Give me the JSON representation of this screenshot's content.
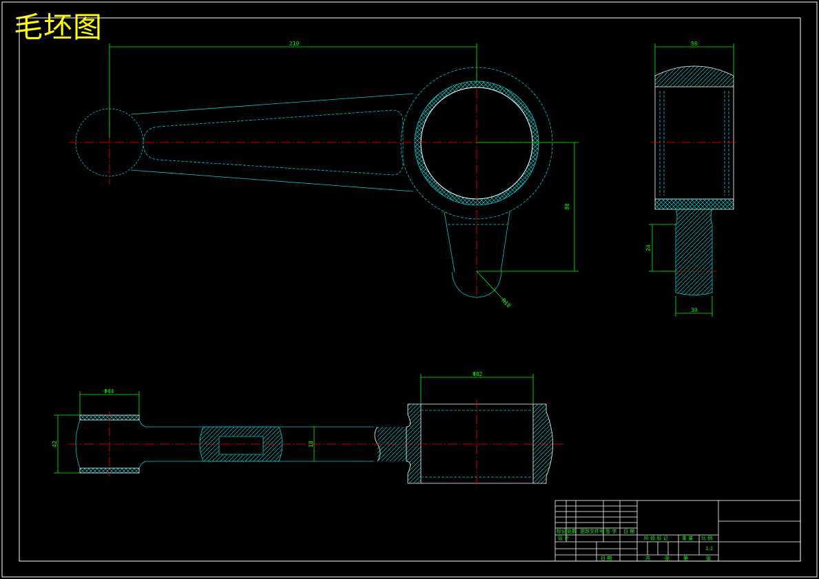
{
  "drawing": {
    "title": "毛坯图"
  },
  "dimensions": {
    "center_distance": "210",
    "big_end_width": "56",
    "offset_height": "88",
    "boss_height": "24",
    "boss_width": "30",
    "small_radius": "R18",
    "small_end_dia": "Φ44",
    "small_end_height": "42",
    "web_thickness": "18",
    "big_bore_dia": "Φ82"
  },
  "title_block": {
    "marks": [
      "标记",
      "处数",
      "更改文件号",
      "签 字",
      "日 期"
    ],
    "designer": "设 计",
    "approve_date": "日 期",
    "stage": [
      "阶 段 标 记",
      "重 量",
      "比 例"
    ],
    "scale": "1:1",
    "sheet": [
      "共",
      "张",
      "第",
      "张"
    ]
  },
  "colors": {
    "frame": "#ffffff",
    "outline": "#00cccc",
    "center": "#ff0000",
    "dimension": "#00ff00",
    "title": "#ffff00"
  }
}
